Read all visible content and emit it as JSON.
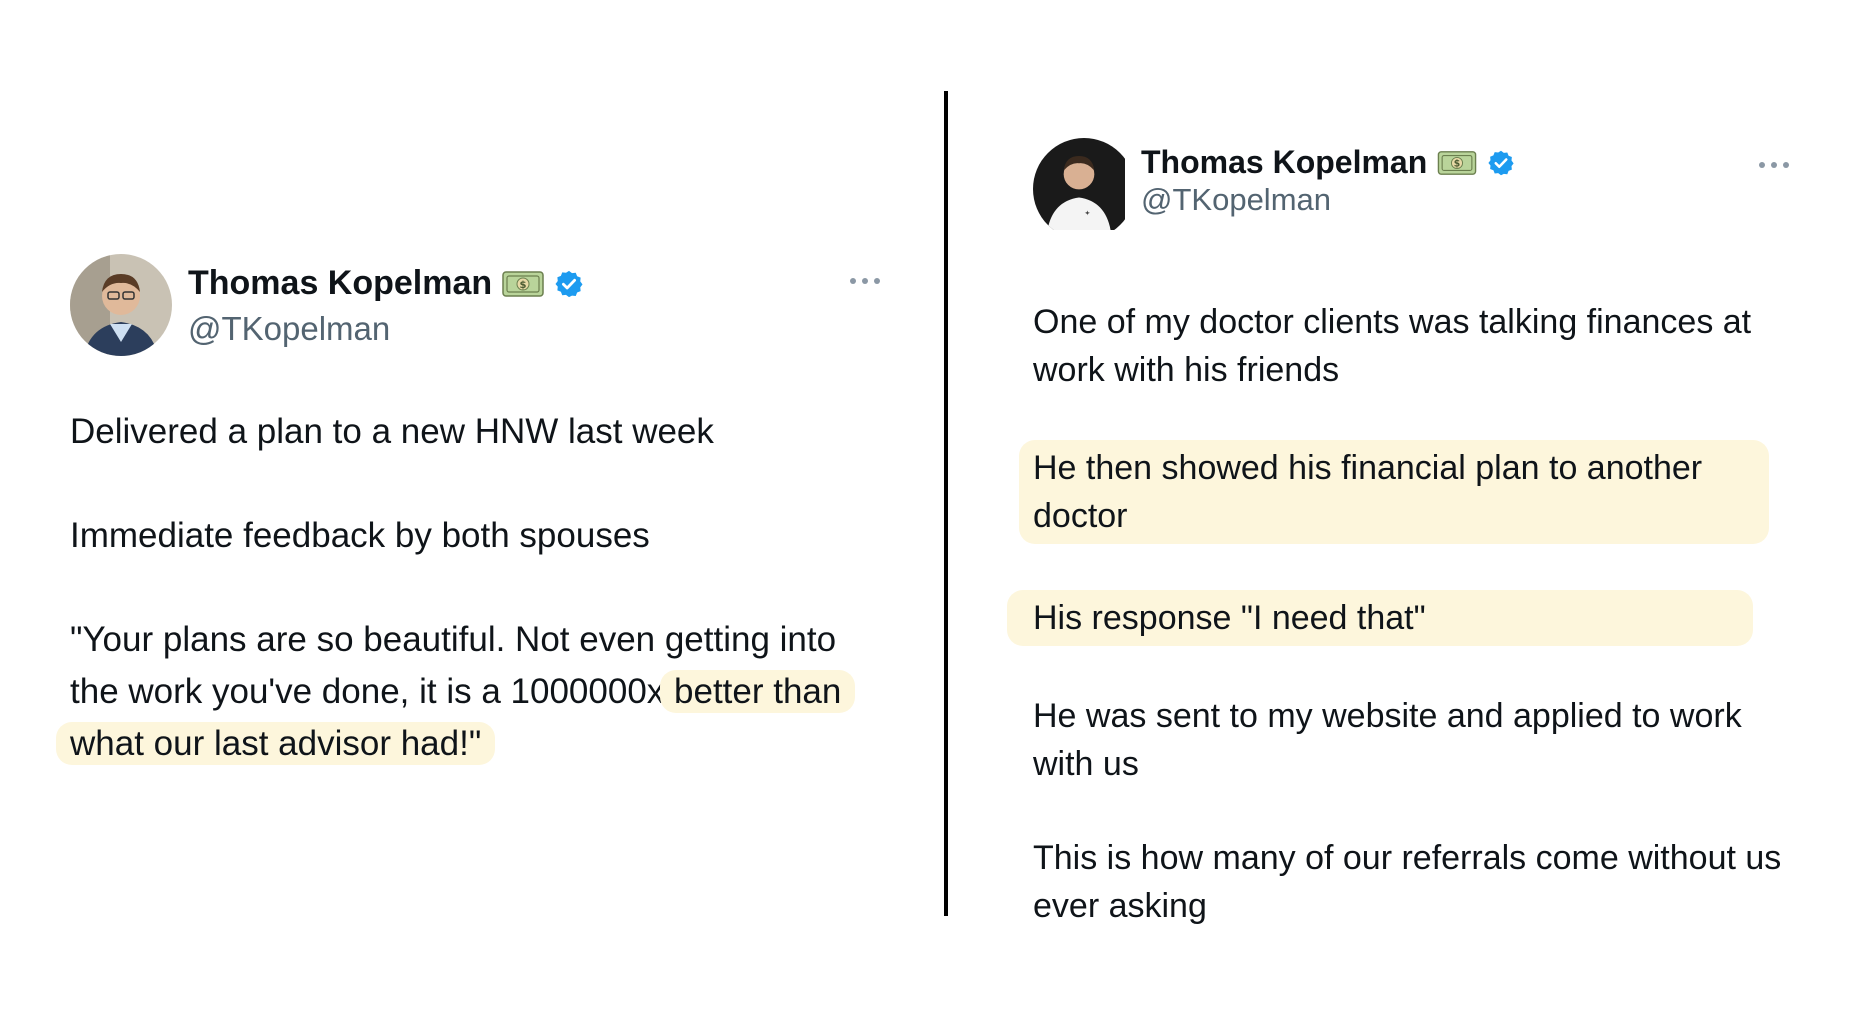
{
  "left_tweet": {
    "display_name": "Thomas Kopelman",
    "handle": "@TKopelman",
    "paragraphs": [
      "Delivered a plan to a new HNW last week",
      "Immediate feedback by both spouses"
    ],
    "quote_plain": "\"Your plans are so beautiful. Not even getting into the work you've done, it is a 1000000x ",
    "quote_highlighted": "better than what our last advisor had!\""
  },
  "right_tweet": {
    "display_name": "Thomas Kopelman",
    "handle": "@TKopelman",
    "paragraph_1": "One of my doctor clients was talking finances at work with his friends",
    "paragraph_2_highlighted": "He then showed his financial plan to another doctor",
    "paragraph_3_highlighted": "His response \"I need that\"",
    "paragraph_4": "He was sent to my website and applied to work with us",
    "paragraph_5": "This is how many of our referrals come without us ever asking"
  },
  "colors": {
    "highlight": "#fdf6dc",
    "verified_badge": "#1d9bf0",
    "handle_text": "#536471",
    "divider": "#000000"
  },
  "icons": {
    "money": "dollar-banknote-icon",
    "verified": "verified-badge-icon",
    "more": "more-options-icon"
  }
}
